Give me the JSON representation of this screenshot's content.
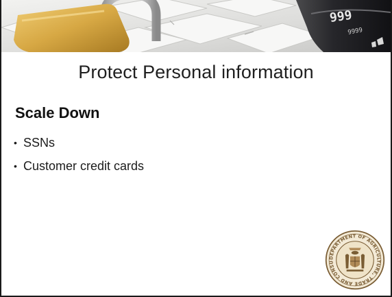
{
  "slide": {
    "title": "Protect Personal information",
    "heading": "Scale Down",
    "bullets": [
      "SSNs",
      "Customer credit cards"
    ]
  },
  "banner": {
    "card_digits": "999",
    "card_small_digits": "9999"
  },
  "seal": {
    "ring_text": "DEPARTMENT OF AGRICULTURE, TRADE AND CONSUMER PROTECTION • WISCONSIN"
  },
  "colors": {
    "seal_ink": "#7a5d34",
    "padlock_gold": "#d7a844",
    "card_dark": "#1e1e22"
  }
}
